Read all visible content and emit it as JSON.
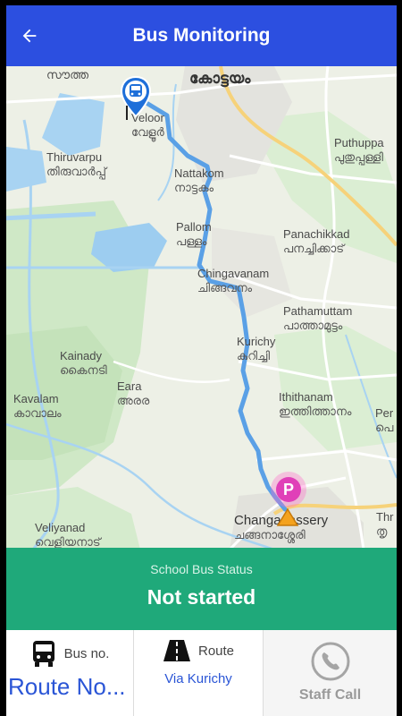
{
  "app_bar": {
    "title": "Bus Monitoring"
  },
  "colors": {
    "app_bar": "#2c4fe0",
    "status_panel": "#1fa97a",
    "route_line": "#5aa0e6",
    "accent_text": "#2a55d6"
  },
  "map": {
    "labels": [
      {
        "en": "സൗത്ത",
        "ml": ""
      },
      {
        "en": "കോട്ടയം",
        "ml": ""
      },
      {
        "en": "Veloor",
        "ml": "വേളൂർ"
      },
      {
        "en": "Thiruvarpu",
        "ml": "തിരുവാർപ്പ്"
      },
      {
        "en": "Puthuppa",
        "ml": "പുതുപ്പള്ളി"
      },
      {
        "en": "Nattakom",
        "ml": "നാട്ടകം"
      },
      {
        "en": "Pallom",
        "ml": "പള്ളം"
      },
      {
        "en": "Panachikkad",
        "ml": "പനച്ചിക്കാട്"
      },
      {
        "en": "Chingavanam",
        "ml": "ചിങ്ങവനം"
      },
      {
        "en": "Pathamuttam",
        "ml": "പാത്താമുട്ടം"
      },
      {
        "en": "Kurichy",
        "ml": "കുറിച്ചി"
      },
      {
        "en": "Kainady",
        "ml": "കൈനടി"
      },
      {
        "en": "Eara",
        "ml": "അരര"
      },
      {
        "en": "Kavalam",
        "ml": "കാവാലം"
      },
      {
        "en": "Ithithanam",
        "ml": "ഇത്തിത്താനം"
      },
      {
        "en": "Per",
        "ml": "പെ"
      },
      {
        "en": "Changanassery",
        "ml": "ചങ്ങനാശ്ശേരി"
      },
      {
        "en": "Veliyanad",
        "ml": "വെളിയനാട്"
      },
      {
        "en": "Thr",
        "ml": "തൃ"
      }
    ],
    "bus_marker_icon": "bus-pin-icon",
    "parking_marker_label": "P",
    "destination_marker_icon": "home-marker-icon"
  },
  "status": {
    "caption": "School Bus Status",
    "value": "Not started"
  },
  "bottom_bar": {
    "bus": {
      "icon": "bus-icon",
      "label": "Bus no.",
      "value": "Route No..."
    },
    "route": {
      "icon": "road-icon",
      "label": "Route",
      "value": "Via Kurichy"
    },
    "call": {
      "icon": "phone-icon",
      "label": "Staff Call"
    }
  }
}
